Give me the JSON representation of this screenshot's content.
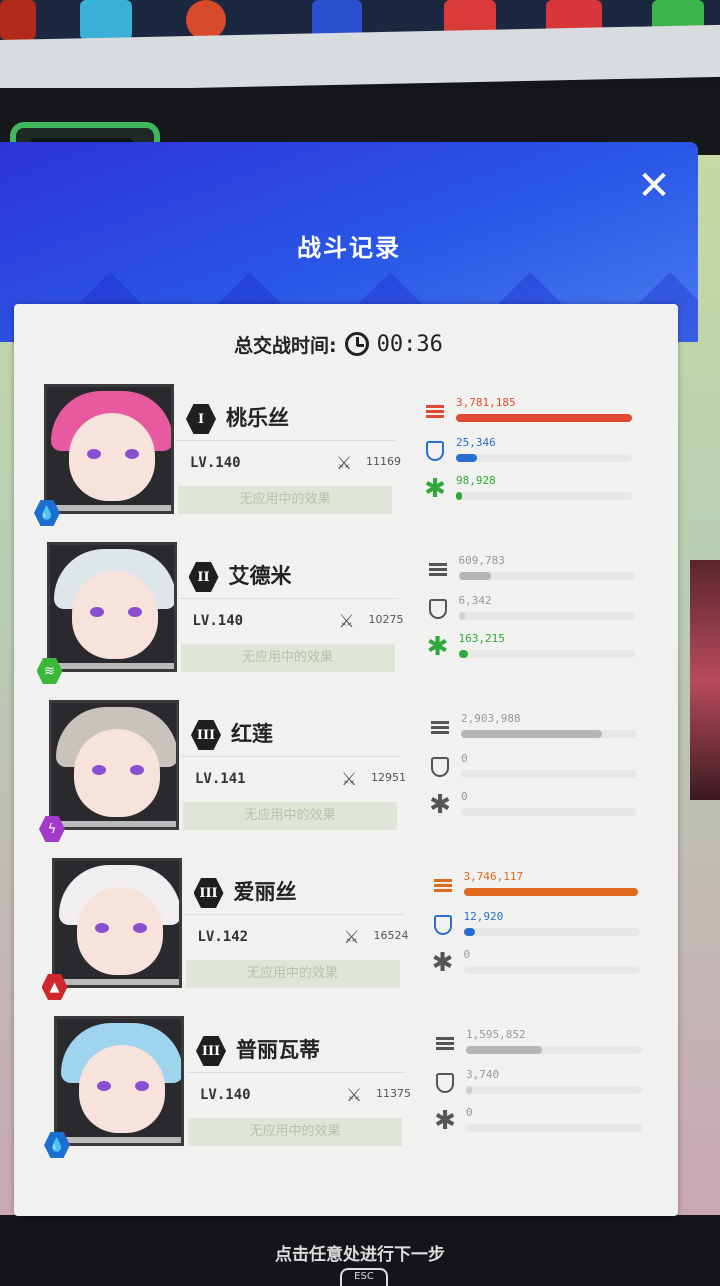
{
  "dialog": {
    "title": "战斗记录",
    "timer_label": "总交战时间:",
    "timer_value": "00:36"
  },
  "characters": [
    {
      "rank": "I",
      "name": "桃乐丝",
      "level": "LV.140",
      "power": "11169",
      "effect": "无应用中的效果",
      "element": "water",
      "hair_color": "#e85aa0",
      "damage": "3,781,185",
      "damage_ratio": 1.0,
      "shield": "25,346",
      "shield_ratio": 0.12,
      "heal": "98,928",
      "heal_ratio": 0.03,
      "accent": "#e04a32"
    },
    {
      "rank": "II",
      "name": "艾德米",
      "level": "LV.140",
      "power": "10275",
      "effect": "无应用中的效果",
      "element": "wind",
      "hair_color": "#dfe6ea",
      "damage": "609,783",
      "damage_ratio": 0.18,
      "shield": "6,342",
      "shield_ratio": 0.03,
      "heal": "163,215",
      "heal_ratio": 0.05,
      "accent": "#3cae3c"
    },
    {
      "rank": "III",
      "name": "红莲",
      "level": "LV.141",
      "power": "12951",
      "effect": "无应用中的效果",
      "element": "electric",
      "hair_color": "#c9c3bd",
      "damage": "2,903,988",
      "damage_ratio": 0.8,
      "shield": "0",
      "shield_ratio": 0,
      "heal": "0",
      "heal_ratio": 0,
      "accent": "#888888"
    },
    {
      "rank": "III",
      "name": "爱丽丝",
      "level": "LV.142",
      "power": "16524",
      "effect": "无应用中的效果",
      "element": "fire",
      "hair_color": "#f1eef2",
      "damage": "3,746,117",
      "damage_ratio": 0.99,
      "shield": "12,920",
      "shield_ratio": 0.06,
      "heal": "0",
      "heal_ratio": 0,
      "accent": "#e06a1e"
    },
    {
      "rank": "III",
      "name": "普丽瓦蒂",
      "level": "LV.140",
      "power": "11375",
      "effect": "无应用中的效果",
      "element": "water",
      "hair_color": "#9fd4ef",
      "damage": "1,595,852",
      "damage_ratio": 0.43,
      "shield": "3,740",
      "shield_ratio": 0.02,
      "heal": "0",
      "heal_ratio": 0,
      "accent": "#999999"
    }
  ],
  "footer": {
    "hint": "点击任意处进行下一步",
    "esc": "ESC"
  },
  "icons": {
    "close": "close-icon",
    "clock": "clock-icon",
    "damage": "damage-icon",
    "shield": "shield-icon",
    "heal": "heal-icon",
    "power": "crossed-swords-icon"
  }
}
